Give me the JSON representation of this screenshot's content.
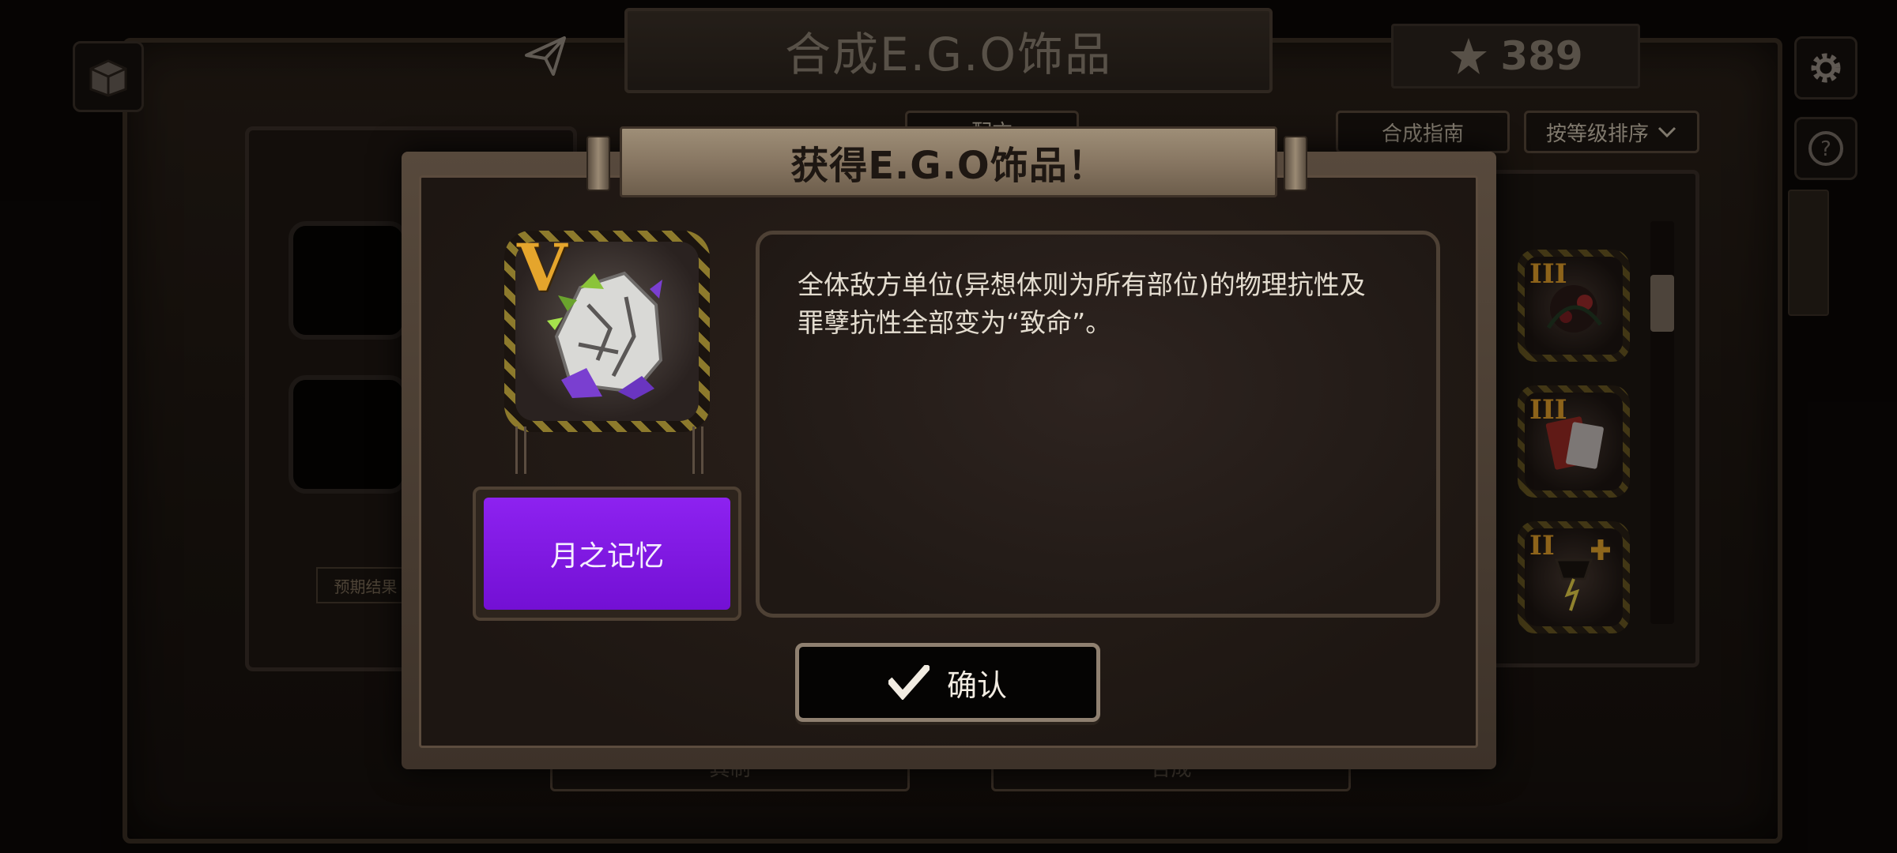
{
  "header": {
    "title": "合成E.G.O饰品",
    "currency_amount": "389"
  },
  "toolbar": {
    "tab_partial": "配方",
    "guide_button": "合成指南",
    "sort_select": "按等级排序"
  },
  "workbench": {
    "expected_result_label": "预期结果",
    "bottom_button_left": "其制",
    "bottom_button_right": "合成"
  },
  "inventory": {
    "items": [
      {
        "tier": "III"
      },
      {
        "tier": "III"
      },
      {
        "tier": "II"
      }
    ]
  },
  "modal": {
    "title": "获得E.G.O饰品！",
    "item_tier": "V",
    "item_name": "月之记忆",
    "description_line1": "全体敌方单位(异想体则为所有部位)的物理抗性及",
    "description_line2": "罪孽抗性全部变为“致命”。",
    "confirm_label": "确认"
  },
  "colors": {
    "name_plate": "#8d22f0",
    "tier_gold": "#e5a52c",
    "frame": "#57493c"
  },
  "icons": [
    "share-icon",
    "star-currency-icon",
    "settings-icon",
    "help-icon",
    "checkmark-icon",
    "chevron-down-icon"
  ]
}
